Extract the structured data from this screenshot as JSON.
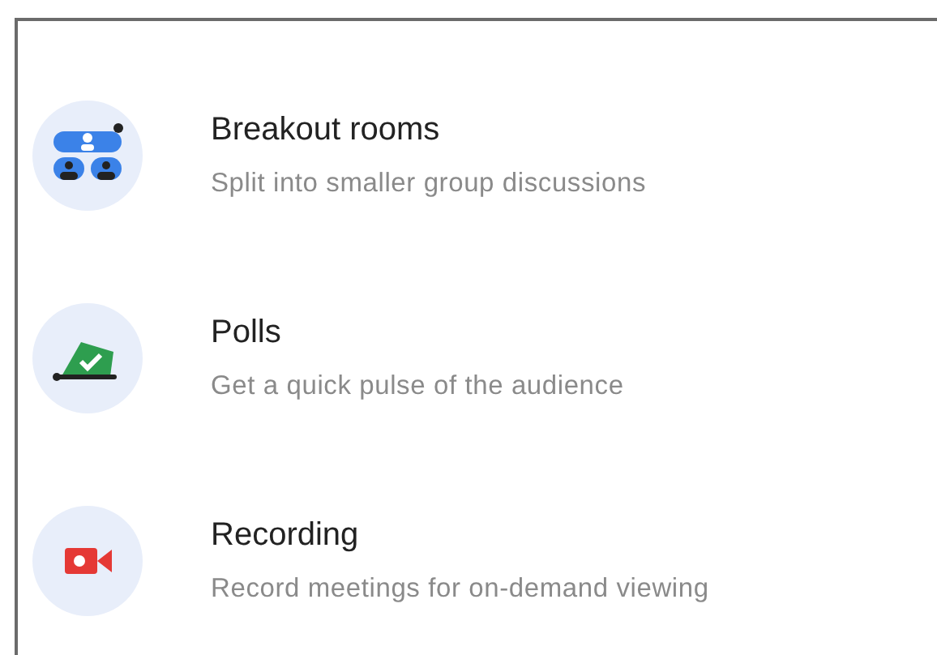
{
  "features": [
    {
      "kind": "breakout",
      "title": "Breakout rooms",
      "subtitle": "Split into smaller group discussions"
    },
    {
      "kind": "polls",
      "title": "Polls",
      "subtitle": "Get a quick pulse of the audience"
    },
    {
      "kind": "recording",
      "title": "Recording",
      "subtitle": "Record meetings for on-demand viewing"
    }
  ]
}
